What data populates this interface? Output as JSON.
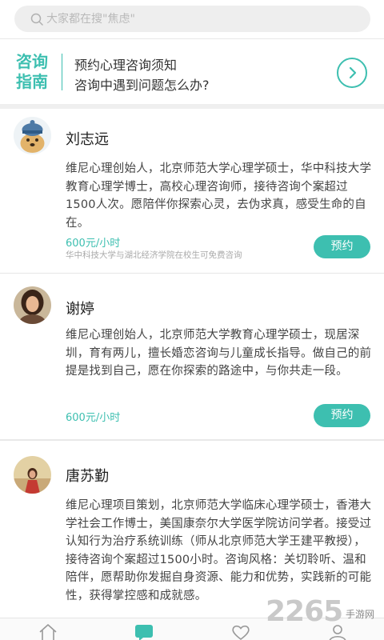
{
  "search": {
    "placeholder": "大家都在搜\"焦虑\""
  },
  "guide": {
    "title_line1": "咨询",
    "title_line2": "指南",
    "item1": "预约心理咨询须知",
    "item2": "咨询中遇到问题怎么办?"
  },
  "counselors": [
    {
      "name": "刘志远",
      "desc": "维尼心理创始人，北京师范大学心理学硕士，华中科技大学教育心理学博士，高校心理咨询师，接待咨询个案超过1500人次。愿陪伴你探索心灵，去伪求真，感受生命的自在。",
      "price": "600元/小时",
      "note": "华中科技大学与湖北经济学院在校生可免费咨询",
      "button": "预约"
    },
    {
      "name": "谢婷",
      "desc": "维尼心理创始人，北京师范大学教育心理学硕士，现居深圳，育有两儿，擅长婚恋咨询与儿童成长指导。做自己的前提是找到自己，愿在你探索的路途中，与你共走一段。",
      "price": "600元/小时",
      "button": "预约"
    },
    {
      "name": "唐苏勤",
      "desc": "维尼心理项目策划，北京师范大学临床心理学硕士，香港大学社会工作博士，美国康奈尔大学医学院访问学者。接受过认知行为治疗系统训练（师从北京师范大学王建平教授），接待咨询个案超过1500小时。咨询风格：关切聆听、温和陪伴，愿帮助你发掘自身资源、能力和优势，实践新的可能性，获得掌控感和成就感。"
    }
  ],
  "watermark": {
    "number": "2265",
    "text": "手游网"
  },
  "colors": {
    "accent": "#3dbfb0"
  }
}
